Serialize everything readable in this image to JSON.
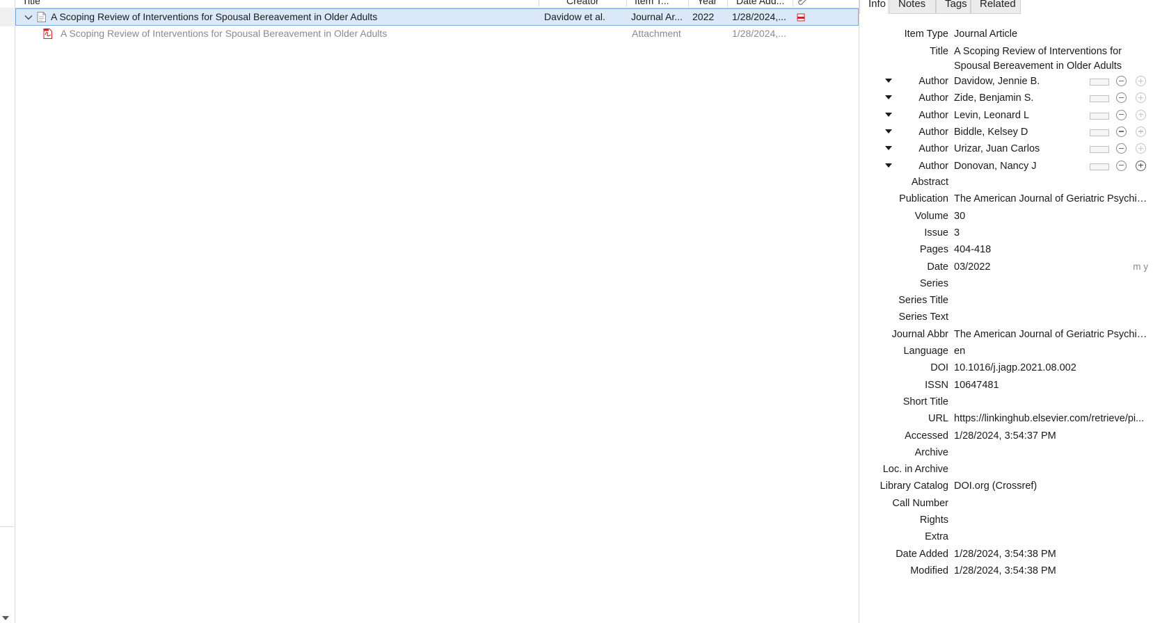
{
  "columns": {
    "title": "Title",
    "creator": "Creator",
    "item_type": "Item T...",
    "year": "Year",
    "date_added": "Date Add..."
  },
  "items": [
    {
      "title": "A Scoping Review of Interventions for Spousal Bereavement in Older Adults",
      "creator": "Davidow et al.",
      "item_type": "Journal Ar...",
      "year": "2022",
      "date_added": "1/28/2024,..."
    },
    {
      "title": "A Scoping Review of Interventions for Spousal Bereavement in Older Adults",
      "item_type": "Attachment",
      "date_added": "1/28/2024,..."
    }
  ],
  "tabs": [
    "Info",
    "Notes",
    "Tags",
    "Related"
  ],
  "info": {
    "item_type_label": "Item Type",
    "item_type_value": "Journal Article",
    "title_label": "Title",
    "title_value": "A Scoping Review of Interventions for Spousal Bereavement in Older Adults",
    "authors": [
      {
        "label": "Author",
        "name": "Davidow, Jennie B."
      },
      {
        "label": "Author",
        "name": "Zide, Benjamin S."
      },
      {
        "label": "Author",
        "name": "Levin, Leonard L"
      },
      {
        "label": "Author",
        "name": "Biddle, Kelsey D"
      },
      {
        "label": "Author",
        "name": "Urizar, Juan Carlos"
      },
      {
        "label": "Author",
        "name": "Donovan, Nancy J"
      }
    ],
    "fields": [
      {
        "label": "Abstract",
        "value": ""
      },
      {
        "label": "Publication",
        "value": "The American Journal of Geriatric Psychiatry"
      },
      {
        "label": "Volume",
        "value": "30"
      },
      {
        "label": "Issue",
        "value": "3"
      },
      {
        "label": "Pages",
        "value": "404-418"
      },
      {
        "label": "Date",
        "value": "03/2022",
        "hint": "m y"
      },
      {
        "label": "Series",
        "value": ""
      },
      {
        "label": "Series Title",
        "value": ""
      },
      {
        "label": "Series Text",
        "value": ""
      },
      {
        "label": "Journal Abbr",
        "value": "The American Journal of Geriatric Psychiatry"
      },
      {
        "label": "Language",
        "value": "en"
      },
      {
        "label": "DOI",
        "value": "10.1016/j.jagp.2021.08.002"
      },
      {
        "label": "ISSN",
        "value": "10647481"
      },
      {
        "label": "Short Title",
        "value": ""
      },
      {
        "label": "URL",
        "value": "https://linkinghub.elsevier.com/retrieve/pi..."
      },
      {
        "label": "Accessed",
        "value": "1/28/2024, 3:54:37 PM"
      },
      {
        "label": "Archive",
        "value": ""
      },
      {
        "label": "Loc. in Archive",
        "value": ""
      },
      {
        "label": "Library Catalog",
        "value": "DOI.org (Crossref)"
      },
      {
        "label": "Call Number",
        "value": ""
      },
      {
        "label": "Rights",
        "value": ""
      },
      {
        "label": "Extra",
        "value": ""
      },
      {
        "label": "Date Added",
        "value": "1/28/2024, 3:54:38 PM"
      },
      {
        "label": "Modified",
        "value": "1/28/2024, 3:54:38 PM"
      }
    ]
  },
  "colors": {
    "selection_bg": "#dbe8f7",
    "selection_border": "#7aa9e0",
    "pdf_red": "#d42020",
    "muted_text": "#8a8a8a"
  }
}
